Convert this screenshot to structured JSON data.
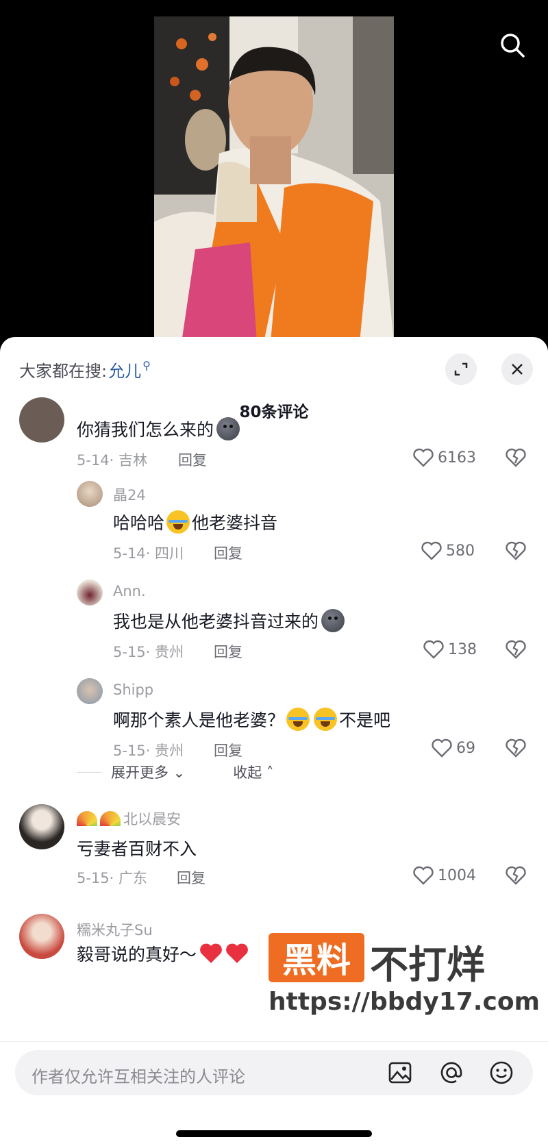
{
  "hot_search": {
    "prefix": "大家都在搜:",
    "keyword": "允儿"
  },
  "comment_count": "80条评论",
  "comments": [
    {
      "text": "你猜我们怎么来的",
      "date": "5-14",
      "location": "吉林",
      "reply_label": "回复",
      "likes": "6163"
    },
    {
      "username": "晶24",
      "text_parts": [
        "哈哈哈",
        "他老婆抖音"
      ],
      "date": "5-14",
      "location": "四川",
      "reply_label": "回复",
      "likes": "580"
    },
    {
      "username": "Ann.",
      "text": "我也是从他老婆抖音过来的",
      "date": "5-15",
      "location": "贵州",
      "reply_label": "回复",
      "likes": "138"
    },
    {
      "username": "Shipp",
      "text_parts": [
        "啊那个素人是他老婆？",
        "不是吧"
      ],
      "date": "5-15",
      "location": "贵州",
      "reply_label": "回复",
      "likes": "69"
    },
    {
      "username": "北以晨安",
      "text": "亏妻者百财不入",
      "date": "5-15",
      "location": "广东",
      "reply_label": "回复",
      "likes": "1004"
    },
    {
      "username": "糯米丸子Su",
      "text": "毅哥说的真好～"
    }
  ],
  "expand_more": "展开更多",
  "collapse": "收起",
  "input_placeholder": "作者仅允许互相关注的人评论",
  "watermark": {
    "brand_left": "黑料",
    "brand_right": "不打烊",
    "url": "https://bbdy17.com"
  },
  "icons": [
    "search-icon",
    "expand-icon",
    "close-icon",
    "heart-icon",
    "dislike-icon",
    "image-icon",
    "at-icon",
    "emoji-icon"
  ],
  "colors": {
    "keyword_blue": "#2a5ca8",
    "watermark_orange": "#ee6d23",
    "jacket_orange": "#f07a1e"
  }
}
